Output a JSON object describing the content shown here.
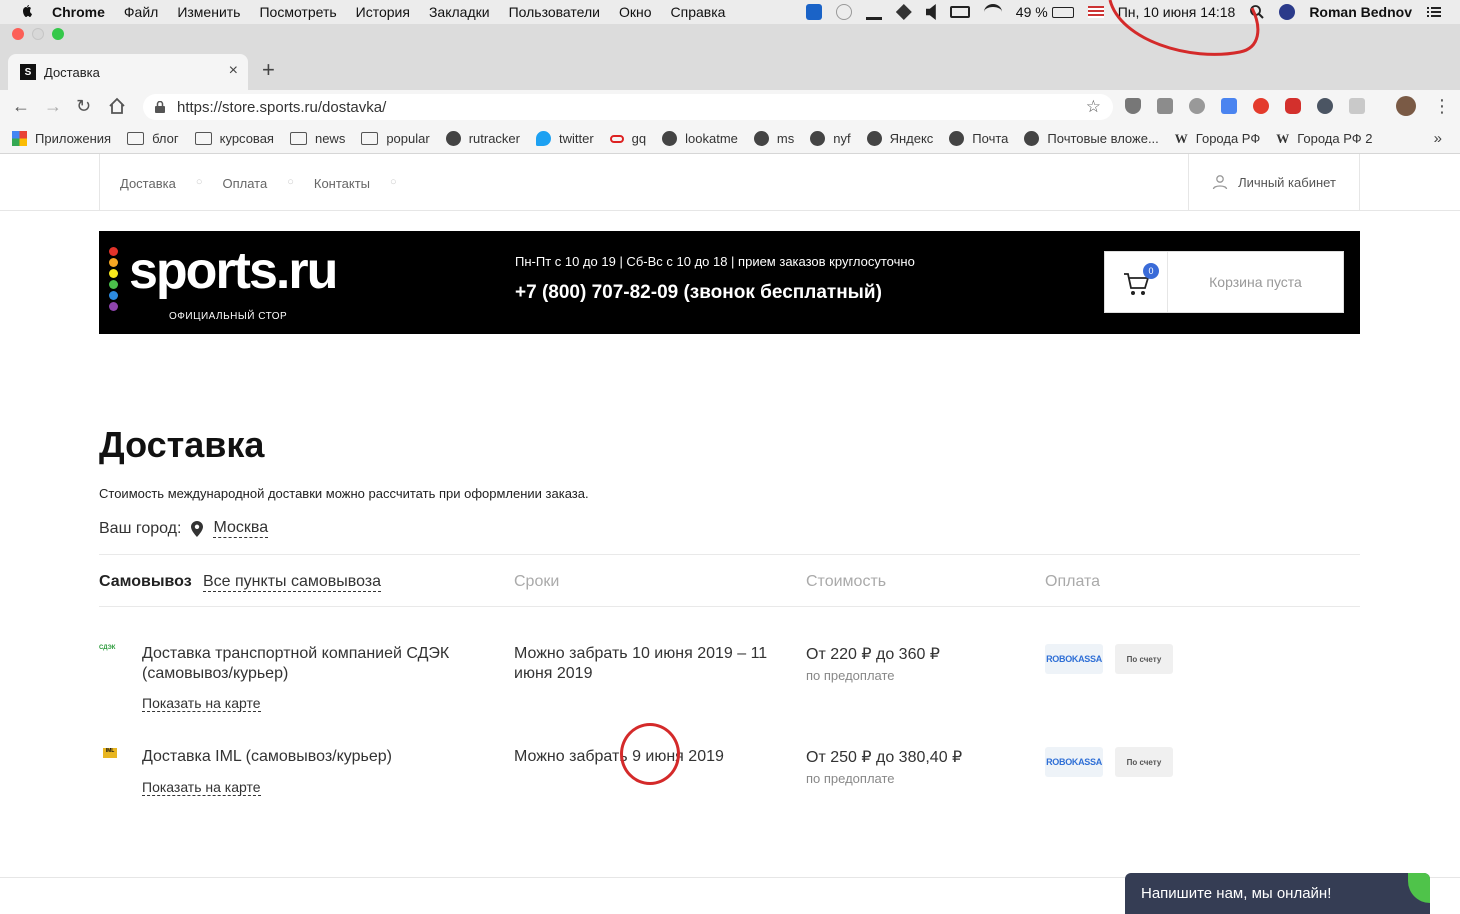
{
  "menubar": {
    "app": "Chrome",
    "items": [
      "Файл",
      "Изменить",
      "Посмотреть",
      "История",
      "Закладки",
      "Пользователи",
      "Окно",
      "Справка"
    ],
    "battery": "49 %",
    "datetime": "Пн, 10 июня  14:18",
    "user": "Roman Bednov"
  },
  "tab": {
    "title": "Доставка",
    "favicon": "S"
  },
  "omnibox": {
    "url": "https://store.sports.ru/dostavka/"
  },
  "bookmarks": [
    {
      "label": "Приложения",
      "icon": "apps-grid"
    },
    {
      "label": "блог",
      "icon": "folder"
    },
    {
      "label": "курсовая",
      "icon": "folder"
    },
    {
      "label": "news",
      "icon": "folder"
    },
    {
      "label": "popular",
      "icon": "folder"
    },
    {
      "label": "rutracker",
      "icon": "globe"
    },
    {
      "label": "twitter",
      "icon": "twitter-bird"
    },
    {
      "label": "gq",
      "icon": "gq"
    },
    {
      "label": "lookatme",
      "icon": "globe"
    },
    {
      "label": "ms",
      "icon": "globe"
    },
    {
      "label": "nyf",
      "icon": "globe"
    },
    {
      "label": "Яндекс",
      "icon": "globe"
    },
    {
      "label": "Почта",
      "icon": "globe"
    },
    {
      "label": "Почтовые вложе...",
      "icon": "globe"
    },
    {
      "label": "Города РФ",
      "icon": "wikipedia"
    },
    {
      "label": "Города РФ 2",
      "icon": "wikipedia"
    }
  ],
  "bookmarks_more": "»",
  "site": {
    "nav": [
      "Доставка",
      "Оплата",
      "Контакты"
    ],
    "cabinet": "Личный кабинет",
    "logo": "sports.ru",
    "logo_sub": "ОФИЦИАЛЬНЫЙ СТОР",
    "hours": "Пн-Пт с 10 до 19 | Сб-Вс с 10 до 18 | прием заказов круглосуточно",
    "phone": "+7 (800) 707-82-09 (звонок бесплатный)",
    "cart_count": "0",
    "cart_label": "Корзина пуста"
  },
  "delivery": {
    "title": "Доставка",
    "intl_note": "Стоимость международной доставки можно рассчитать при оформлении заказа.",
    "city_label": "Ваш город:",
    "city": "Москва",
    "headers": {
      "pickup": "Самовывоз",
      "all_points": "Все пункты самовывоза",
      "terms": "Сроки",
      "cost": "Стоимость",
      "payment": "Оплата"
    },
    "rows": [
      {
        "carrier_logo": "СДЭК",
        "title": "Доставка транспортной компанией СДЭК (самовывоз/курьер)",
        "map_link": "Показать на карте",
        "term": "Можно забрать 10 июня 2019 – 11 июня 2019",
        "cost": "От 220 ₽ до 360 ₽",
        "cost_note": "по предоплате",
        "payments": [
          "ROBOKASSA",
          "По счету"
        ]
      },
      {
        "carrier_logo": "IML",
        "title": "Доставка IML (самовывоз/курьер)",
        "map_link": "Показать на карте",
        "term": "Можно забрать 9 июня 2019",
        "cost": "От 250 ₽ до 380,40 ₽",
        "cost_note": "по предоплате",
        "payments": [
          "ROBOKASSA",
          "По счету"
        ]
      }
    ]
  },
  "chat": {
    "label": "Напишите нам, мы онлайн!"
  },
  "colors": {
    "annotation": "#d42a2a",
    "accent": "#3a6bd8",
    "chat_bg": "#353d54"
  }
}
